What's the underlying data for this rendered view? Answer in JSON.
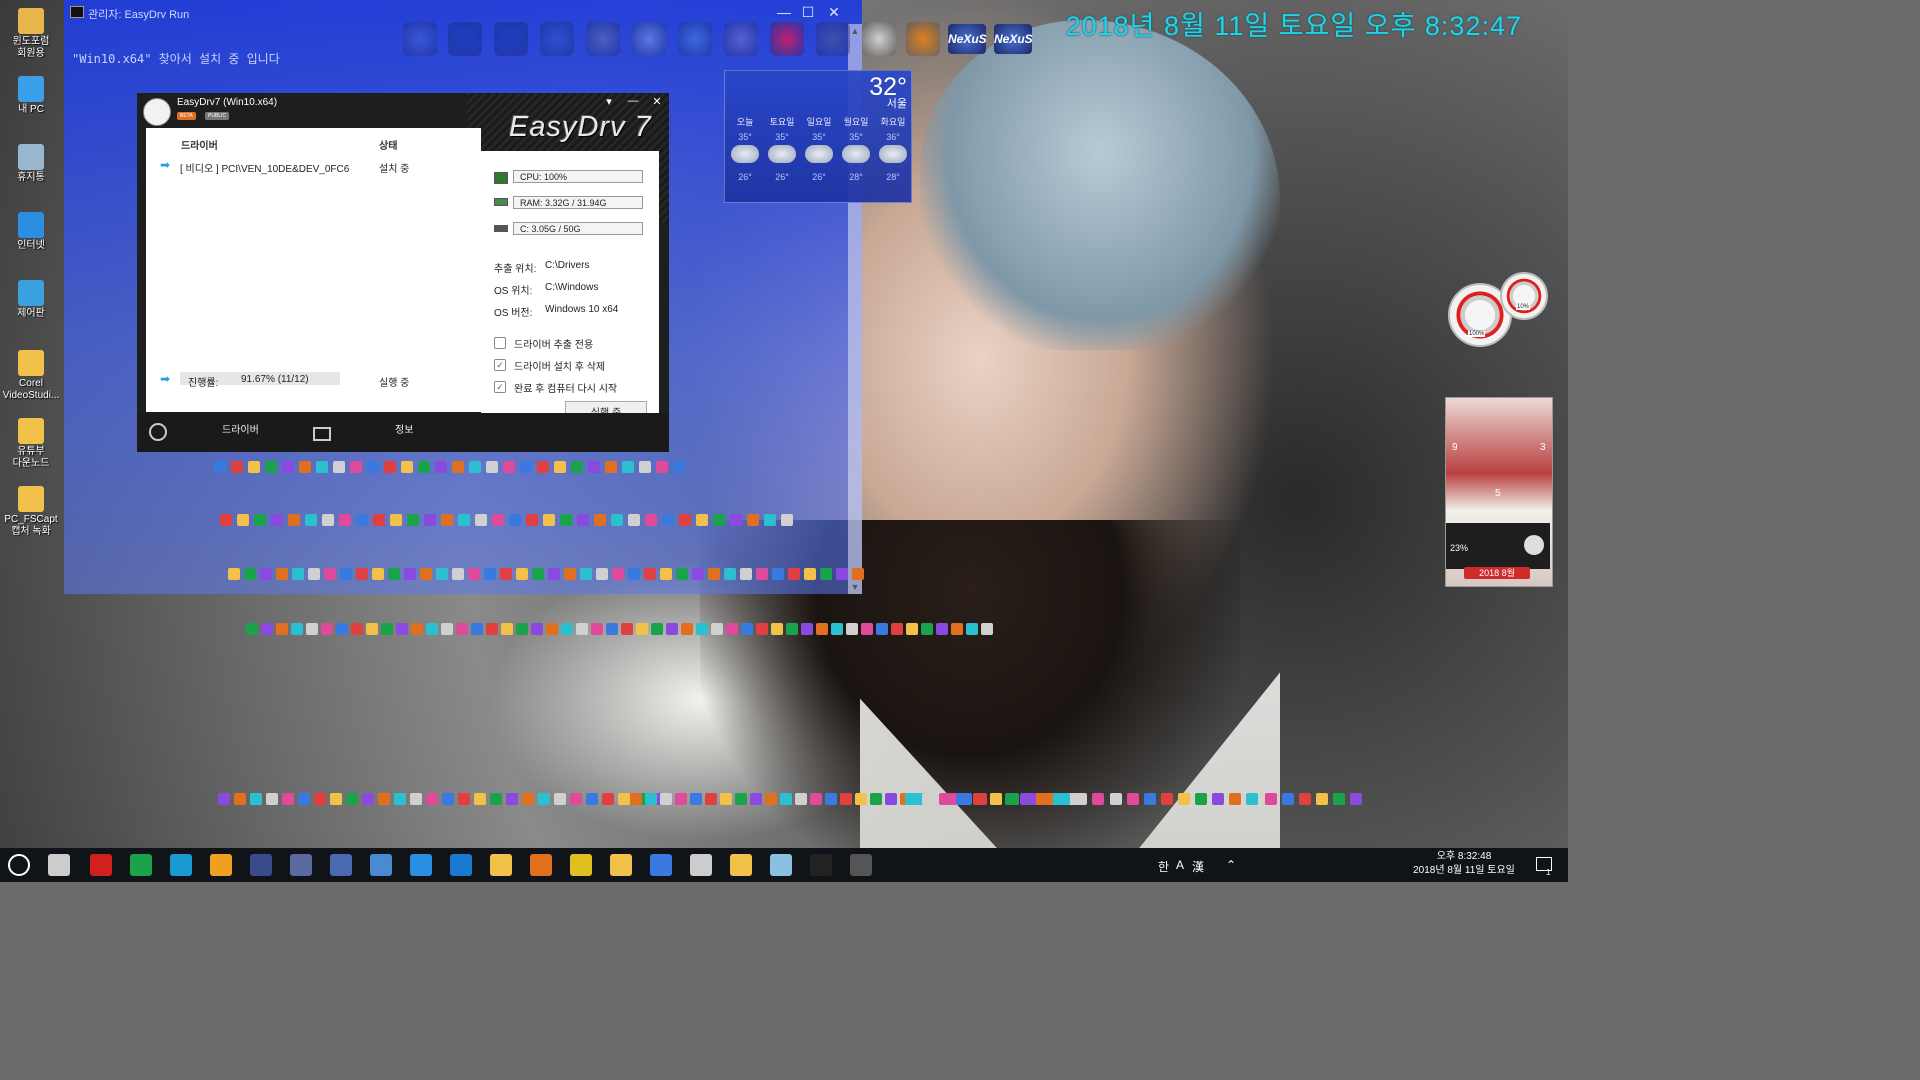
{
  "desktop_icons": [
    {
      "label": "윈도포럼\n회원용",
      "icon": "folder-user-icon",
      "color": "#e8b64a"
    },
    {
      "label": "내 PC",
      "icon": "computer-icon",
      "color": "#3a9ee8"
    },
    {
      "label": "휴지통",
      "icon": "recycle-bin-icon",
      "color": "#9ab7d0"
    },
    {
      "label": "인터넷",
      "icon": "internet-explorer-icon",
      "color": "#2a8fe0"
    },
    {
      "label": "제어판",
      "icon": "control-panel-icon",
      "color": "#3aa0e0"
    },
    {
      "label": "Corel\nVideoStudi...",
      "icon": "folder-icon",
      "color": "#f2c14a"
    },
    {
      "label": "유튜부\n다운노드",
      "icon": "folder-icon",
      "color": "#f2c14a"
    },
    {
      "label": "PC_FSCapt\n캡처 녹화",
      "icon": "folder-icon",
      "color": "#f2c14a"
    }
  ],
  "top_clock": "2018년 8월 11일 토요일 오후 8:32:47",
  "console": {
    "title": "관리자:  EasyDrv Run",
    "text": "\"Win10.x64\" 찾아서 설치 중 입니다",
    "minimize": "—",
    "maximize": "☐",
    "close": "✕"
  },
  "quick_launch": [
    {
      "icon": "ie-settings-icon",
      "color": "#3a58d8"
    },
    {
      "icon": "undo-arrow-icon",
      "color": "#2040c0"
    },
    {
      "icon": "redo-arrow-icon",
      "color": "#2040c0"
    },
    {
      "icon": "monitor-icon",
      "color": "#3050d0"
    },
    {
      "icon": "speaker-icon",
      "color": "#4a60c0"
    },
    {
      "icon": "trash-icon",
      "color": "#5a7ae0"
    },
    {
      "icon": "globe-icon",
      "color": "#3a6ae0"
    },
    {
      "icon": "megaphone-icon",
      "color": "#5860d0"
    },
    {
      "icon": "power-icon",
      "color": "#c02070"
    },
    {
      "icon": "moon-icon",
      "color": "#4050b0"
    },
    {
      "icon": "key-icon",
      "color": "#d0d0d0"
    },
    {
      "icon": "webcam-icon",
      "color": "#e08020"
    }
  ],
  "nexus_labels": [
    "NeXuS",
    "NeXuS"
  ],
  "weather": {
    "temp": "32°",
    "city": "서울",
    "days": [
      {
        "day": "오늘",
        "hi": "35°",
        "lo": "26°"
      },
      {
        "day": "토요일",
        "hi": "35°",
        "lo": "26°"
      },
      {
        "day": "일요일",
        "hi": "35°",
        "lo": "26°"
      },
      {
        "day": "월요일",
        "hi": "35°",
        "lo": "28°"
      },
      {
        "day": "화요일",
        "hi": "36°",
        "lo": "28°"
      }
    ]
  },
  "easydrv": {
    "title": "EasyDrv7 (Win10.x64)",
    "badge_beta": "BETA",
    "badge_public": "PUBLIC",
    "logo": "EasyDrv 7",
    "col_driver": "드라이버",
    "col_status": "상태",
    "driver_row_name": "[ 비디오 ] PCI\\VEN_10DE&DEV_0FC6",
    "driver_row_status": "설치 중",
    "cpu": "CPU:  100%",
    "ram": "RAM: 3.32G / 31.94G",
    "disk": "C:      3.05G / 50G",
    "extract_label": "추출 위치:",
    "extract_value": "C:\\Drivers",
    "os_loc_label": "OS 위치:",
    "os_loc_value": "C:\\Windows",
    "os_ver_label": "OS 버전:",
    "os_ver_value": "Windows 10 x64",
    "progress_label": "진행률:",
    "progress_value": "91.67% (11/12)",
    "progress_status": "실행 중",
    "opt_extract_only": "드라이버 추출 전용",
    "opt_delete_after": "드라이버 설치 후 삭제",
    "opt_reboot": "완료 후 컴퓨터 다시 시작",
    "run_button": "실행 중",
    "tab_driver": "드라이버",
    "tab_info": "정보",
    "minimize": "—",
    "close": "✕",
    "menu": "▾",
    "checks": {
      "extract_only": false,
      "delete_after": true,
      "reboot": true
    }
  },
  "gadgets": {
    "gauge_big": "100%",
    "gauge_small": "10%",
    "photo_left_num": "9",
    "photo_right_num": "3",
    "photo_bottom_num": "5",
    "volume": "23%",
    "date": "2018 8월"
  },
  "taskbar": {
    "lang_1": "한",
    "lang_2": "A",
    "lang_3": "漢",
    "time": "오후 8:32:48",
    "date": "2018년 8월 11일 토요일",
    "notify_count": "1",
    "apps": [
      {
        "icon": "cortana-icon",
        "color": "#ffffff"
      },
      {
        "icon": "task-view-icon",
        "color": "#cccccc"
      },
      {
        "icon": "power-app-icon",
        "color": "#d02020"
      },
      {
        "icon": "green-app-icon",
        "color": "#1aa34a"
      },
      {
        "icon": "network-app-icon",
        "color": "#1a9ad0"
      },
      {
        "icon": "shutdown-app-icon",
        "color": "#f0a020"
      },
      {
        "icon": "nexus-app-icon",
        "color": "#3a4a8a"
      },
      {
        "icon": "folder-app-icon",
        "color": "#5a6aa0"
      },
      {
        "icon": "settings-app-icon",
        "color": "#4a6ab0"
      },
      {
        "icon": "control-app-icon",
        "color": "#4a8ad0"
      },
      {
        "icon": "ie-app-icon",
        "color": "#2a8fe0"
      },
      {
        "icon": "edge-app-icon",
        "color": "#1a7ad0"
      },
      {
        "icon": "explorer-app-icon",
        "color": "#f2c14a"
      },
      {
        "icon": "firefox-app-icon",
        "color": "#e0701a"
      },
      {
        "icon": "chrome-app-icon",
        "color": "#e0c020"
      },
      {
        "icon": "files-app-icon",
        "color": "#f2c14a"
      },
      {
        "icon": "store-app-icon",
        "color": "#3a7ae0"
      },
      {
        "icon": "mail-app-icon",
        "color": "#cccccc"
      },
      {
        "icon": "folder2-app-icon",
        "color": "#f2c14a"
      },
      {
        "icon": "tools-app-icon",
        "color": "#8ac0e0"
      },
      {
        "icon": "console-app-icon",
        "color": "#222222"
      },
      {
        "icon": "tablet-app-icon",
        "color": "#555555"
      }
    ]
  }
}
